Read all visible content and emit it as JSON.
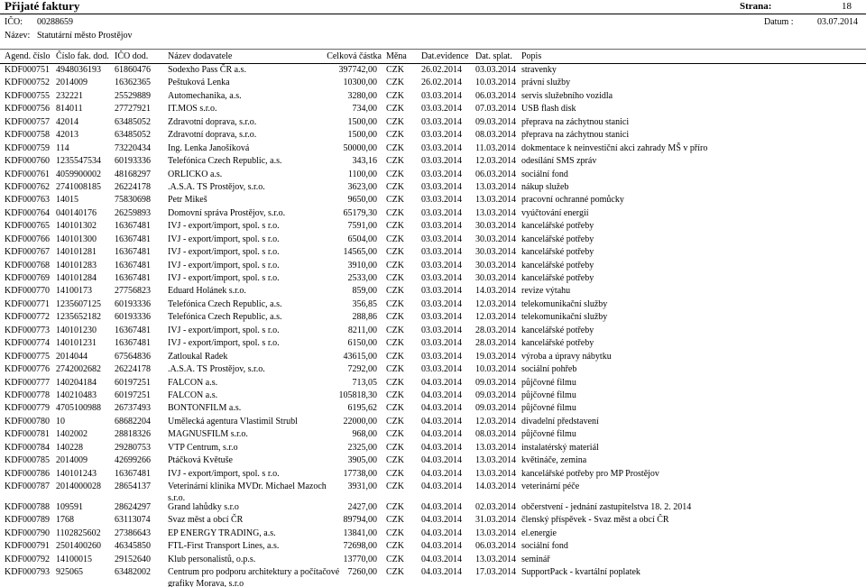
{
  "report": {
    "title": "Přijaté faktury",
    "page_label": "Strana:",
    "page_number": "18",
    "ico_label": "IČO:",
    "ico_value": "00288659",
    "name_label": "Název:",
    "name_value": "Statutární město Prostějov",
    "date_label": "Datum :",
    "date_value": "03.07.2014"
  },
  "columns": {
    "agend": "Agend. číslo",
    "cislo": "Číslo fak. dod.",
    "ico": "IČO dod.",
    "nazev": "Název dodavatele",
    "castka": "Celková částka",
    "mena": "Měna",
    "dat_evidence": "Dat.evidence",
    "dat_splat": "Dat. splat.",
    "popis": "Popis"
  },
  "rows": [
    {
      "agend": "KDF000751",
      "cislo": "4948036193",
      "ico": "61860476",
      "nazev": "Sodexho Pass ČR a.s.",
      "castka": "397742,00",
      "mena": "CZK",
      "dat_evidence": "26.02.2014",
      "dat_splat": "03.03.2014",
      "popis": "stravenky"
    },
    {
      "agend": "KDF000752",
      "cislo": "2014009",
      "ico": "16362365",
      "nazev": "Peštuková Lenka",
      "castka": "10300,00",
      "mena": "CZK",
      "dat_evidence": "26.02.2014",
      "dat_splat": "10.03.2014",
      "popis": "právní služby"
    },
    {
      "agend": "KDF000755",
      "cislo": "232221",
      "ico": "25529889",
      "nazev": "Automechanika, a.s.",
      "castka": "3280,00",
      "mena": "CZK",
      "dat_evidence": "03.03.2014",
      "dat_splat": "06.03.2014",
      "popis": "servis služebního vozidla"
    },
    {
      "agend": "KDF000756",
      "cislo": "814011",
      "ico": "27727921",
      "nazev": "IT.MOS s.r.o.",
      "castka": "734,00",
      "mena": "CZK",
      "dat_evidence": "03.03.2014",
      "dat_splat": "07.03.2014",
      "popis": "USB flash disk"
    },
    {
      "agend": "KDF000757",
      "cislo": "42014",
      "ico": "63485052",
      "nazev": "Zdravotní doprava, s.r.o.",
      "castka": "1500,00",
      "mena": "CZK",
      "dat_evidence": "03.03.2014",
      "dat_splat": "09.03.2014",
      "popis": "přeprava na záchytnou stanici"
    },
    {
      "agend": "KDF000758",
      "cislo": "42013",
      "ico": "63485052",
      "nazev": "Zdravotní doprava, s.r.o.",
      "castka": "1500,00",
      "mena": "CZK",
      "dat_evidence": "03.03.2014",
      "dat_splat": "08.03.2014",
      "popis": "přeprava na záchytnou stanici"
    },
    {
      "agend": "KDF000759",
      "cislo": "114",
      "ico": "73220434",
      "nazev": "Ing. Lenka Janošíková",
      "castka": "50000,00",
      "mena": "CZK",
      "dat_evidence": "03.03.2014",
      "dat_splat": "11.03.2014",
      "popis": "dokmentace k neinvestiční akci zahrady MŠ v příro"
    },
    {
      "agend": "KDF000760",
      "cislo": "1235547534",
      "ico": "60193336",
      "nazev": "Telefónica Czech Republic, a.s.",
      "castka": "343,16",
      "mena": "CZK",
      "dat_evidence": "03.03.2014",
      "dat_splat": "12.03.2014",
      "popis": "odesílání SMS zpráv"
    },
    {
      "agend": "KDF000761",
      "cislo": "4059900002",
      "ico": "48168297",
      "nazev": "ORLICKO a.s.",
      "castka": "1100,00",
      "mena": "CZK",
      "dat_evidence": "03.03.2014",
      "dat_splat": "06.03.2014",
      "popis": "sociální fond"
    },
    {
      "agend": "KDF000762",
      "cislo": "2741008185",
      "ico": "26224178",
      "nazev": ".A.S.A. TS Prostějov, s.r.o.",
      "castka": "3623,00",
      "mena": "CZK",
      "dat_evidence": "03.03.2014",
      "dat_splat": "13.03.2014",
      "popis": "nákup služeb"
    },
    {
      "agend": "KDF000763",
      "cislo": "14015",
      "ico": "75830698",
      "nazev": "Petr Mikeš",
      "castka": "9650,00",
      "mena": "CZK",
      "dat_evidence": "03.03.2014",
      "dat_splat": "13.03.2014",
      "popis": "pracovní ochranné pomůcky"
    },
    {
      "agend": "KDF000764",
      "cislo": "040140176",
      "ico": "26259893",
      "nazev": "Domovní správa Prostějov, s.r.o.",
      "castka": "65179,30",
      "mena": "CZK",
      "dat_evidence": "03.03.2014",
      "dat_splat": "13.03.2014",
      "popis": "vyúčtování energií"
    },
    {
      "agend": "KDF000765",
      "cislo": "140101302",
      "ico": "16367481",
      "nazev": "IVJ - export/import, spol. s r.o.",
      "castka": "7591,00",
      "mena": "CZK",
      "dat_evidence": "03.03.2014",
      "dat_splat": "30.03.2014",
      "popis": "kancelářské potřeby"
    },
    {
      "agend": "KDF000766",
      "cislo": "140101300",
      "ico": "16367481",
      "nazev": "IVJ - export/import, spol. s r.o.",
      "castka": "6504,00",
      "mena": "CZK",
      "dat_evidence": "03.03.2014",
      "dat_splat": "30.03.2014",
      "popis": "kancelářské potřeby"
    },
    {
      "agend": "KDF000767",
      "cislo": "140101281",
      "ico": "16367481",
      "nazev": "IVJ - export/import, spol. s r.o.",
      "castka": "14565,00",
      "mena": "CZK",
      "dat_evidence": "03.03.2014",
      "dat_splat": "30.03.2014",
      "popis": "kancelářské potřeby"
    },
    {
      "agend": "KDF000768",
      "cislo": "140101283",
      "ico": "16367481",
      "nazev": "IVJ - export/import, spol. s r.o.",
      "castka": "3910,00",
      "mena": "CZK",
      "dat_evidence": "03.03.2014",
      "dat_splat": "30.03.2014",
      "popis": "kancelářské potřeby"
    },
    {
      "agend": "KDF000769",
      "cislo": "140101284",
      "ico": "16367481",
      "nazev": "IVJ - export/import, spol. s r.o.",
      "castka": "2533,00",
      "mena": "CZK",
      "dat_evidence": "03.03.2014",
      "dat_splat": "30.03.2014",
      "popis": "kancelářské potřeby"
    },
    {
      "agend": "KDF000770",
      "cislo": "14100173",
      "ico": "27756823",
      "nazev": "Eduard Holánek s.r.o.",
      "castka": "859,00",
      "mena": "CZK",
      "dat_evidence": "03.03.2014",
      "dat_splat": "14.03.2014",
      "popis": "revize výtahu"
    },
    {
      "agend": "KDF000771",
      "cislo": "1235607125",
      "ico": "60193336",
      "nazev": "Telefónica Czech Republic, a.s.",
      "castka": "356,85",
      "mena": "CZK",
      "dat_evidence": "03.03.2014",
      "dat_splat": "12.03.2014",
      "popis": "telekomunikační služby"
    },
    {
      "agend": "KDF000772",
      "cislo": "1235652182",
      "ico": "60193336",
      "nazev": "Telefónica Czech Republic, a.s.",
      "castka": "288,86",
      "mena": "CZK",
      "dat_evidence": "03.03.2014",
      "dat_splat": "12.03.2014",
      "popis": "telekomunikační služby"
    },
    {
      "agend": "KDF000773",
      "cislo": "140101230",
      "ico": "16367481",
      "nazev": "IVJ - export/import, spol. s r.o.",
      "castka": "8211,00",
      "mena": "CZK",
      "dat_evidence": "03.03.2014",
      "dat_splat": "28.03.2014",
      "popis": "kancelářské potřeby"
    },
    {
      "agend": "KDF000774",
      "cislo": "140101231",
      "ico": "16367481",
      "nazev": "IVJ - export/import, spol. s r.o.",
      "castka": "6150,00",
      "mena": "CZK",
      "dat_evidence": "03.03.2014",
      "dat_splat": "28.03.2014",
      "popis": "kancelářské potřeby"
    },
    {
      "agend": "KDF000775",
      "cislo": "2014044",
      "ico": "67564836",
      "nazev": "Zatloukal Radek",
      "castka": "43615,00",
      "mena": "CZK",
      "dat_evidence": "03.03.2014",
      "dat_splat": "19.03.2014",
      "popis": "výroba a úpravy nábytku"
    },
    {
      "agend": "KDF000776",
      "cislo": "2742002682",
      "ico": "26224178",
      "nazev": ".A.S.A. TS Prostějov, s.r.o.",
      "castka": "7292,00",
      "mena": "CZK",
      "dat_evidence": "03.03.2014",
      "dat_splat": "10.03.2014",
      "popis": "sociální pohřeb"
    },
    {
      "agend": "KDF000777",
      "cislo": "140204184",
      "ico": "60197251",
      "nazev": "FALCON a.s.",
      "castka": "713,05",
      "mena": "CZK",
      "dat_evidence": "04.03.2014",
      "dat_splat": "09.03.2014",
      "popis": "půjčovné filmu"
    },
    {
      "agend": "KDF000778",
      "cislo": "140210483",
      "ico": "60197251",
      "nazev": "FALCON a.s.",
      "castka": "105818,30",
      "mena": "CZK",
      "dat_evidence": "04.03.2014",
      "dat_splat": "09.03.2014",
      "popis": "půjčovné filmu"
    },
    {
      "agend": "KDF000779",
      "cislo": "4705100988",
      "ico": "26737493",
      "nazev": "BONTONFILM a.s.",
      "castka": "6195,62",
      "mena": "CZK",
      "dat_evidence": "04.03.2014",
      "dat_splat": "09.03.2014",
      "popis": "půjčovné filmu"
    },
    {
      "agend": "KDF000780",
      "cislo": "10",
      "ico": "68682204",
      "nazev": "Umělecká agentura Vlastimil Strubl",
      "castka": "22000,00",
      "mena": "CZK",
      "dat_evidence": "04.03.2014",
      "dat_splat": "12.03.2014",
      "popis": "divadelní představení"
    },
    {
      "agend": "KDF000781",
      "cislo": "1402002",
      "ico": "28818326",
      "nazev": "MAGNUSFILM s.r.o.",
      "castka": "968,00",
      "mena": "CZK",
      "dat_evidence": "04.03.2014",
      "dat_splat": "08.03.2014",
      "popis": "půjčovné filmu"
    },
    {
      "agend": "KDF000784",
      "cislo": "140228",
      "ico": "29280753",
      "nazev": "VTP Centrum, s.r.o",
      "castka": "2325,00",
      "mena": "CZK",
      "dat_evidence": "04.03.2014",
      "dat_splat": "13.03.2014",
      "popis": "instalatérský materiál"
    },
    {
      "agend": "KDF000785",
      "cislo": "2014009",
      "ico": "42699266",
      "nazev": "Ptáčková Květuše",
      "castka": "3905,00",
      "mena": "CZK",
      "dat_evidence": "04.03.2014",
      "dat_splat": "13.03.2014",
      "popis": "květináče, zemina"
    },
    {
      "agend": "KDF000786",
      "cislo": "140101243",
      "ico": "16367481",
      "nazev": "IVJ - export/import, spol. s r.o.",
      "castka": "17738,00",
      "mena": "CZK",
      "dat_evidence": "04.03.2014",
      "dat_splat": "13.03.2014",
      "popis": "kancelářské potřeby pro MP Prostějov"
    },
    {
      "agend": "KDF000787",
      "cislo": "2014000028",
      "ico": "28654137",
      "nazev": "Veterinární klinika MVDr. Michael Mazoch",
      "nazev2": "s.r.o.",
      "castka": "3931,00",
      "mena": "CZK",
      "dat_evidence": "04.03.2014",
      "dat_splat": "14.03.2014",
      "popis": "veterinární péče"
    },
    {
      "agend": "KDF000788",
      "cislo": "109591",
      "ico": "28624297",
      "nazev": "Grand lahůdky s.r.o",
      "castka": "2427,00",
      "mena": "CZK",
      "dat_evidence": "04.03.2014",
      "dat_splat": "02.03.2014",
      "popis": "občerstvení - jednání zastupitelstva 18. 2. 2014"
    },
    {
      "agend": "KDF000789",
      "cislo": "1768",
      "ico": "63113074",
      "nazev": "Svaz měst a obcí ČR",
      "castka": "89794,00",
      "mena": "CZK",
      "dat_evidence": "04.03.2014",
      "dat_splat": "31.03.2014",
      "popis": "členský příspěvek - Svaz měst a obcí ČR"
    },
    {
      "agend": "KDF000790",
      "cislo": "1102825602",
      "ico": "27386643",
      "nazev": "EP ENERGY TRADING, a.s.",
      "castka": "13841,00",
      "mena": "CZK",
      "dat_evidence": "04.03.2014",
      "dat_splat": "13.03.2014",
      "popis": "el.energie"
    },
    {
      "agend": "KDF000791",
      "cislo": "2501400260",
      "ico": "46345850",
      "nazev": "FTL-First Transport Lines, a.s.",
      "castka": "72698,00",
      "mena": "CZK",
      "dat_evidence": "04.03.2014",
      "dat_splat": "06.03.2014",
      "popis": "sociální fond"
    },
    {
      "agend": "KDF000792",
      "cislo": "14100015",
      "ico": "29152640",
      "nazev": "Klub personalistů, o.p.s.",
      "castka": "13770,00",
      "mena": "CZK",
      "dat_evidence": "04.03.2014",
      "dat_splat": "13.03.2014",
      "popis": "seminář"
    },
    {
      "agend": "KDF000793",
      "cislo": "925065",
      "ico": "63482002",
      "nazev": "Centrum pro podporu architektury a počítačové",
      "nazev2": "grafiky Morava, s.r.o",
      "castka": "7260,00",
      "mena": "CZK",
      "dat_evidence": "04.03.2014",
      "dat_splat": "17.03.2014",
      "popis": "SupportPack - kvartální poplatek"
    }
  ]
}
